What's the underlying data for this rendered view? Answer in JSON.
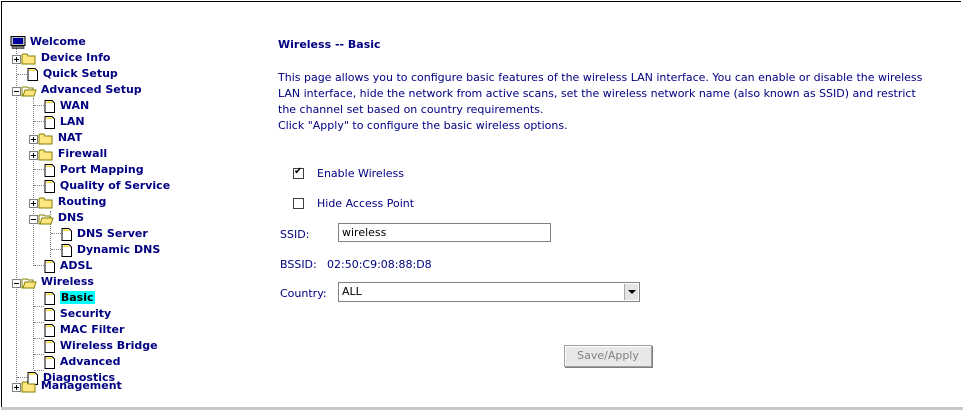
{
  "nav": {
    "welcome": "Welcome",
    "device_info": "Device Info",
    "quick_setup": "Quick Setup",
    "advanced_setup": "Advanced Setup",
    "wan": "WAN",
    "lan": "LAN",
    "nat": "NAT",
    "firewall": "Firewall",
    "port_mapping": "Port Mapping",
    "qos": "Quality of Service",
    "routing": "Routing",
    "dns": "DNS",
    "dns_server": "DNS Server",
    "dynamic_dns": "Dynamic DNS",
    "adsl": "ADSL",
    "wireless": "Wireless",
    "basic": "Basic",
    "security": "Security",
    "mac_filter": "MAC Filter",
    "wireless_bridge": "Wireless Bridge",
    "advanced": "Advanced",
    "diagnostics": "Diagnostics",
    "management": "Management"
  },
  "page": {
    "title": "Wireless -- Basic",
    "description_1": "This page allows you to configure basic features of the wireless LAN interface. You can enable or disable the wireless",
    "description_2": "LAN interface, hide the network from active scans, set the wireless network name (also known as SSID) and restrict",
    "description_3": "the channel set based on country requirements.",
    "description_4": "Click \"Apply\" to configure the basic wireless options.",
    "enable_wireless_label": "Enable Wireless",
    "enable_wireless_checked": true,
    "hide_ap_label": "Hide Access Point",
    "hide_ap_checked": false,
    "ssid_label": "SSID:",
    "ssid_value": "wireless",
    "bssid_label": "BSSID:",
    "bssid_value": "02:50:C9:08:88:D8",
    "country_label": "Country:",
    "country_value": "ALL",
    "save_button": "Save/Apply"
  },
  "colors": {
    "text": "#000080",
    "selected_bg": "#00ffff",
    "folder": "#ffe680"
  }
}
